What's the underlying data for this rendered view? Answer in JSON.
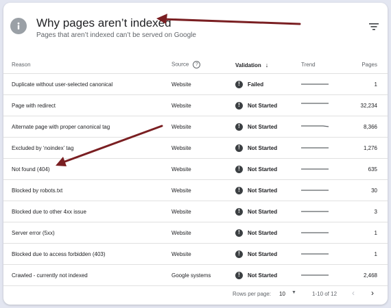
{
  "header": {
    "title": "Why pages aren’t indexed",
    "subtitle": "Pages that aren’t indexed can’t be served on Google",
    "info_icon": "info-icon",
    "filter_icon": "filter-icon"
  },
  "table": {
    "columns": {
      "reason": "Reason",
      "source": "Source",
      "validation": "Validation",
      "trend": "Trend",
      "pages": "Pages"
    },
    "rows": [
      {
        "reason": "Duplicate without user-selected canonical",
        "source": "Website",
        "validation": "Failed",
        "pages": "1"
      },
      {
        "reason": "Page with redirect",
        "source": "Website",
        "validation": "Not Started",
        "pages": "32,234"
      },
      {
        "reason": "Alternate page with proper canonical tag",
        "source": "Website",
        "validation": "Not Started",
        "pages": "8,366"
      },
      {
        "reason": "Excluded by ‘noindex’ tag",
        "source": "Website",
        "validation": "Not Started",
        "pages": "1,276"
      },
      {
        "reason": "Not found (404)",
        "source": "Website",
        "validation": "Not Started",
        "pages": "635"
      },
      {
        "reason": "Blocked by robots.txt",
        "source": "Website",
        "validation": "Not Started",
        "pages": "30"
      },
      {
        "reason": "Blocked due to other 4xx issue",
        "source": "Website",
        "validation": "Not Started",
        "pages": "3"
      },
      {
        "reason": "Server error (5xx)",
        "source": "Website",
        "validation": "Not Started",
        "pages": "1"
      },
      {
        "reason": "Blocked due to access forbidden (403)",
        "source": "Website",
        "validation": "Not Started",
        "pages": "1"
      },
      {
        "reason": "Crawled - currently not indexed",
        "source": "Google systems",
        "validation": "Not Started",
        "pages": "2,468"
      }
    ]
  },
  "footer": {
    "rows_per_page_label": "Rows per page:",
    "rows_per_page_value": "10",
    "range": "1-10 of 12"
  },
  "colors": {
    "annotation_arrow": "#7a1f22",
    "background": "#e3e6f1",
    "status_icon": "#3c4043"
  }
}
